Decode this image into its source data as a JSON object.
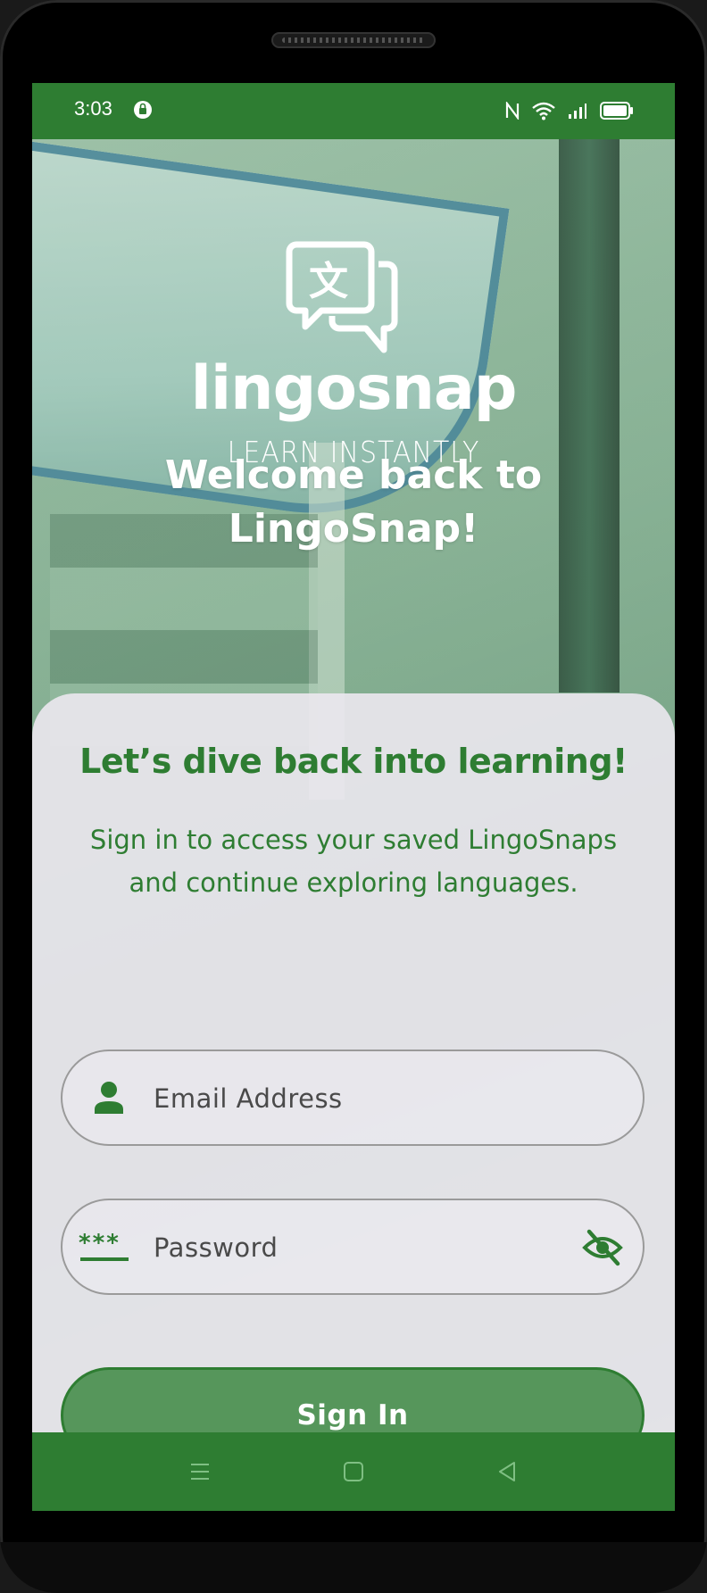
{
  "status_bar": {
    "time": "3:03"
  },
  "logo": {
    "wordmark": "lingosnap",
    "tagline": "LEARN INSTANTLY",
    "glyph": "文"
  },
  "welcome": {
    "line1": "Welcome back to",
    "line2": "LingoSnap!"
  },
  "card": {
    "title": "Let’s dive back into learning!",
    "subtitle_line1": "Sign in to access your saved LingoSnaps",
    "subtitle_line2": "and continue exploring languages."
  },
  "form": {
    "email_placeholder": "Email Address",
    "email_value": "",
    "password_placeholder": "Password",
    "password_value": "",
    "submit_label": "Sign In"
  },
  "colors": {
    "primary": "#2e7d32",
    "button_fill": "#56965b",
    "card_bg": "#ece8f0"
  },
  "icons": [
    "nfc-icon",
    "wifi-icon",
    "signal-icon",
    "battery-icon",
    "person-icon",
    "password-icon",
    "eye-off-icon",
    "menu-icon",
    "home-icon",
    "back-icon"
  ]
}
